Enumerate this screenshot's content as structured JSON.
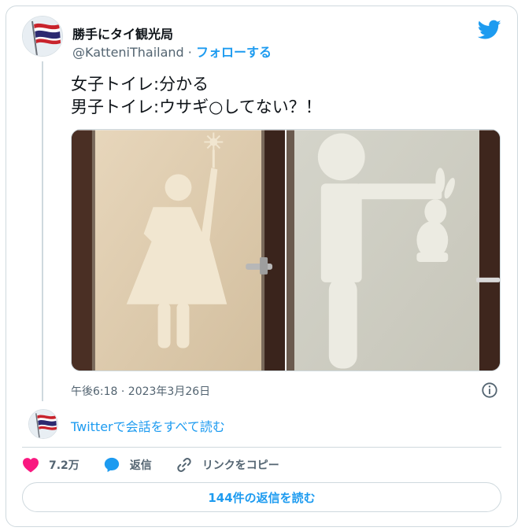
{
  "author": {
    "display_name": "勝手にタイ観光局",
    "handle": "@KatteniThailand",
    "separator": "·",
    "follow_label": "フォローする"
  },
  "tweet": {
    "line1": "女子トイレ:分かる",
    "line2": "男子トイレ:ウサギ○してない？！",
    "timestamp": "午後6:18 · 2023年3月26日"
  },
  "thread": {
    "read_conversation": "Twitterで会話をすべて読む"
  },
  "actions": {
    "like_count": "7.2万",
    "reply_label": "返信",
    "copy_link_label": "リンクをコピー"
  },
  "footer": {
    "read_replies": "144件の返信を読む"
  },
  "icons": {
    "brand": "twitter-bird-icon",
    "info": "info-icon",
    "like": "heart-icon",
    "reply": "speech-bubble-icon",
    "copy": "link-icon"
  },
  "colors": {
    "accent": "#1d9bf0",
    "like": "#f91880",
    "muted": "#536471",
    "text": "#0f1419",
    "border": "#cfd9de"
  }
}
